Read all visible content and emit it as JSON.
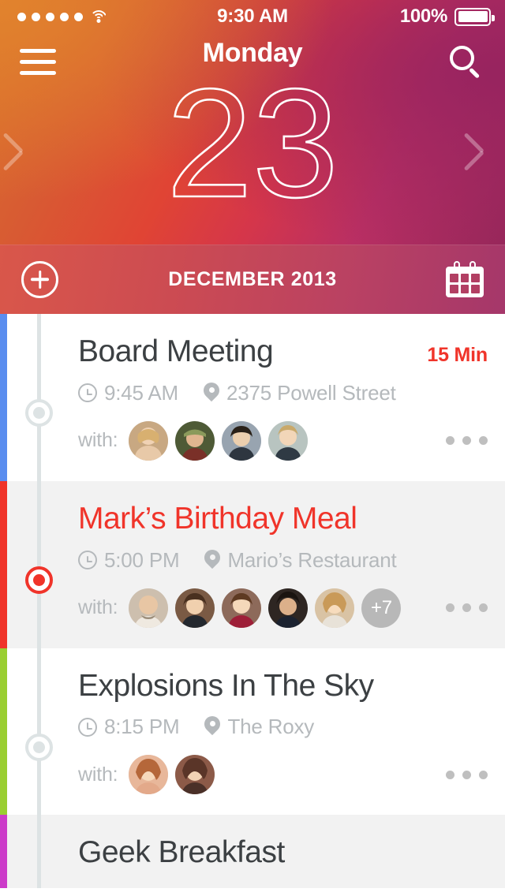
{
  "status_bar": {
    "signal_dots": 5,
    "wifi_icon": "wifi-icon",
    "time": "9:30 AM",
    "battery_percent": "100%",
    "battery_icon": "battery-full-icon"
  },
  "navbar": {
    "menu_icon": "hamburger-menu-icon",
    "title": "Monday",
    "search_icon": "search-icon"
  },
  "hero": {
    "day_number": "23",
    "prev_icon": "chevron-left-icon",
    "next_icon": "chevron-right-icon"
  },
  "month_bar": {
    "add_icon": "plus-circle-icon",
    "label": "DECEMBER 2013",
    "calendar_icon": "calendar-icon"
  },
  "colors": {
    "accent_red": "#f0342a",
    "stripe_blue": "#5a8def",
    "stripe_red": "#f0342a",
    "stripe_green": "#9ace32",
    "stripe_magenta": "#cc3bc9",
    "gradient_start": "#d9712c",
    "gradient_end": "#97275a",
    "muted_gray": "#b5b9bc",
    "title_gray": "#3c4043"
  },
  "events": [
    {
      "title": "Board Meeting",
      "duration": "15 Min",
      "time": "9:45 AM",
      "location": "2375 Powell Street",
      "with_label": "with:",
      "avatar_count": 4,
      "overflow": "",
      "stripe": "#5a8def",
      "active": false,
      "more_icon": "more-options-icon"
    },
    {
      "title": "Mark’s Birthday Meal",
      "duration": "",
      "time": "5:00 PM",
      "location": "Mario’s Restaurant",
      "with_label": "with:",
      "avatar_count": 5,
      "overflow": "+7",
      "stripe": "#f0342a",
      "active": true,
      "more_icon": "more-options-icon"
    },
    {
      "title": "Explosions In The Sky",
      "duration": "",
      "time": "8:15 PM",
      "location": "The Roxy",
      "with_label": "with:",
      "avatar_count": 2,
      "overflow": "",
      "stripe": "#9ace32",
      "active": false,
      "more_icon": "more-options-icon"
    },
    {
      "title": "Geek Breakfast",
      "duration": "",
      "time": "",
      "location": "",
      "with_label": "",
      "avatar_count": 0,
      "overflow": "",
      "stripe": "#cc3bc9",
      "active": false,
      "more_icon": "more-options-icon"
    }
  ]
}
